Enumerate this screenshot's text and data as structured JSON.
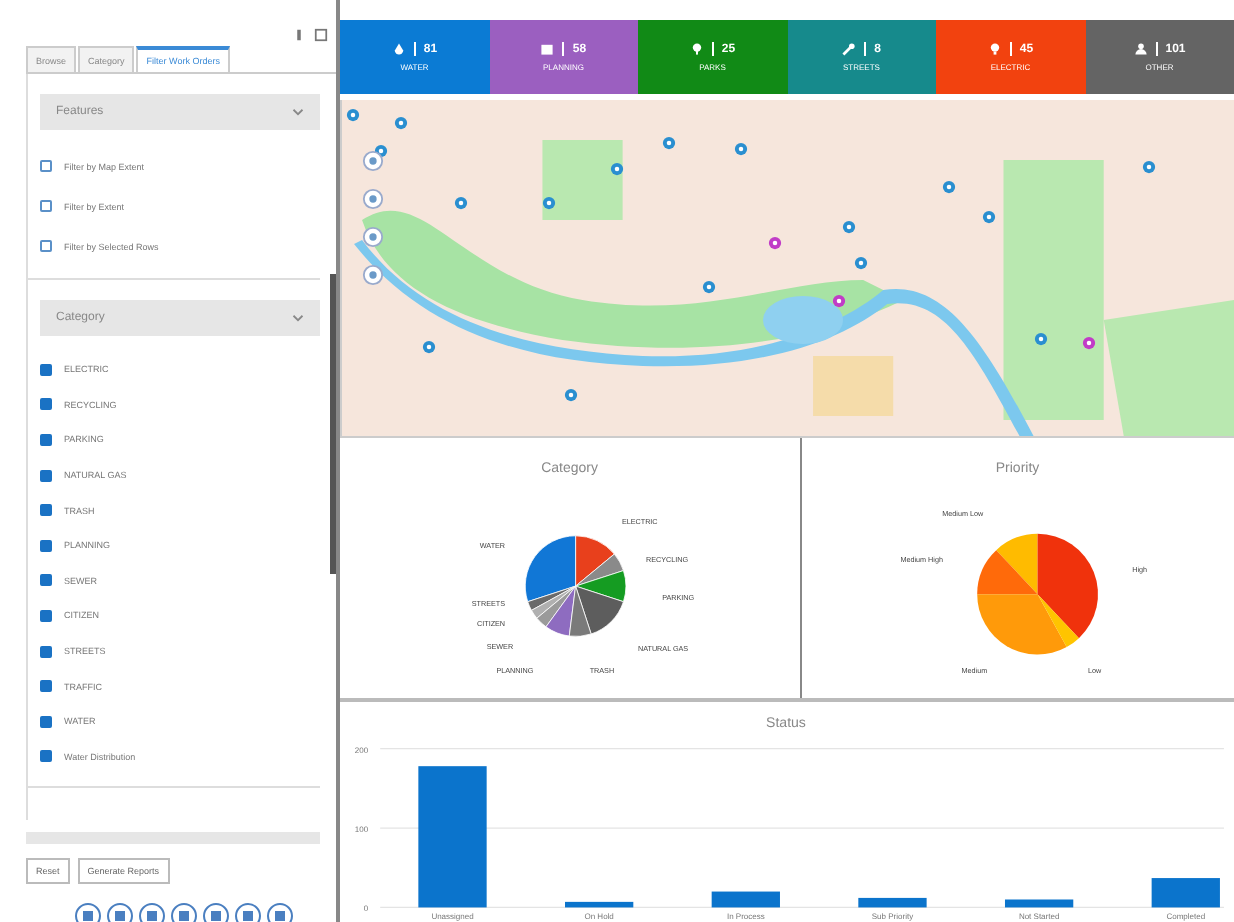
{
  "sidebar": {
    "tabs": [
      {
        "label": "Browse",
        "selected": false
      },
      {
        "label": "Category",
        "selected": false
      },
      {
        "label": "Filter Work Orders",
        "selected": true
      }
    ],
    "features": {
      "title": "Features",
      "options": [
        {
          "label": "Filter by Map Extent",
          "checked": false
        },
        {
          "label": "Filter by Extent",
          "checked": false
        },
        {
          "label": "Filter by Selected Rows",
          "checked": false
        }
      ]
    },
    "category": {
      "title": "Category",
      "items": [
        {
          "label": "ELECTRIC",
          "checked": true
        },
        {
          "label": "RECYCLING",
          "checked": true
        },
        {
          "label": "PARKING",
          "checked": true
        },
        {
          "label": "NATURAL GAS",
          "checked": true
        },
        {
          "label": "TRASH",
          "checked": true
        },
        {
          "label": "PLANNING",
          "checked": true
        },
        {
          "label": "SEWER",
          "checked": true
        },
        {
          "label": "CITIZEN",
          "checked": true
        },
        {
          "label": "STREETS",
          "checked": true
        },
        {
          "label": "TRAFFIC",
          "checked": true
        },
        {
          "label": "WATER",
          "checked": true
        },
        {
          "label": "Water Distribution",
          "checked": true
        }
      ]
    },
    "buttons": [
      "Reset",
      "Generate Reports"
    ]
  },
  "tiles": [
    {
      "kind": "water",
      "count": "81",
      "label": "WATER",
      "color": "#0b7bd4"
    },
    {
      "kind": "planning",
      "count": "58",
      "label": "PLANNING",
      "color": "#9b5fc0"
    },
    {
      "kind": "parks",
      "count": "25",
      "label": "PARKS",
      "color": "#118a16"
    },
    {
      "kind": "streets",
      "count": "8",
      "label": "STREETS",
      "color": "#168a8c"
    },
    {
      "kind": "electric",
      "count": "45",
      "label": "ELECTRIC",
      "color": "#f2420f"
    },
    {
      "kind": "other",
      "count": "101",
      "label": "OTHER",
      "color": "#646464"
    }
  ],
  "category_chart": {
    "title": "Category",
    "labels": [
      "ELECTRIC",
      "WATER",
      "RECYCLING",
      "PARKING",
      "STREETS",
      "CITIZEN",
      "SEWER",
      "NATURAL GAS",
      "PLANNING",
      "TRASH"
    ]
  },
  "priority_chart": {
    "title": "Priority",
    "labels": [
      "Medium Low",
      "Medium High",
      "High",
      "Medium",
      "Low"
    ]
  },
  "status_chart": {
    "chart_data": {
      "type": "bar",
      "title": "Status",
      "categories": [
        "Unassigned",
        "On Hold",
        "In Process",
        "Sub Priority",
        "Not Started",
        "Completed"
      ],
      "ylim": [
        0,
        200
      ],
      "yticks": [
        0,
        100,
        200
      ],
      "series": [
        {
          "color": "#0b74cc",
          "values": [
            178,
            7,
            20,
            12,
            10,
            37
          ]
        }
      ]
    }
  }
}
